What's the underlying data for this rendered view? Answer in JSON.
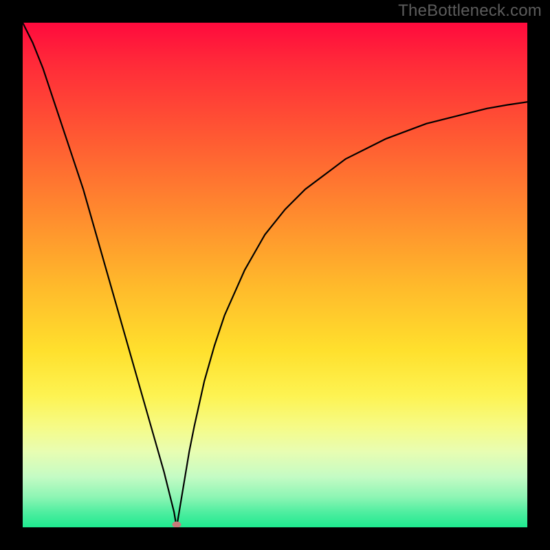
{
  "watermark": "TheBottleneck.com",
  "chart_data": {
    "type": "line",
    "title": "",
    "xlabel": "",
    "ylabel": "",
    "xlim": [
      0,
      100
    ],
    "ylim": [
      0,
      100
    ],
    "background_gradient": {
      "top": "#ff0a3d",
      "bottom": "#1ee98f",
      "meaning": "red=high, green=low"
    },
    "minimum_point": {
      "x": 30.5,
      "y": 0
    },
    "marker": {
      "x": 30.5,
      "y": 0.5,
      "color": "#c77a7a"
    },
    "series": [
      {
        "name": "left-branch",
        "x": [
          0,
          2,
          4,
          6,
          8,
          10,
          12,
          14,
          16,
          18,
          20,
          22,
          24,
          26,
          28,
          29,
          30,
          30.5
        ],
        "y": [
          100,
          96,
          91,
          85,
          79,
          73,
          67,
          60,
          53,
          46,
          39,
          32,
          25,
          18,
          11,
          7,
          3,
          0
        ]
      },
      {
        "name": "right-branch",
        "x": [
          30.5,
          31,
          32,
          33,
          34,
          36,
          38,
          40,
          44,
          48,
          52,
          56,
          60,
          64,
          68,
          72,
          76,
          80,
          84,
          88,
          92,
          96,
          100
        ],
        "y": [
          0,
          3,
          9,
          15,
          20,
          29,
          36,
          42,
          51,
          58,
          63,
          67,
          70,
          73,
          75,
          77,
          78.5,
          80,
          81,
          82,
          83,
          83.7,
          84.3
        ]
      }
    ]
  }
}
